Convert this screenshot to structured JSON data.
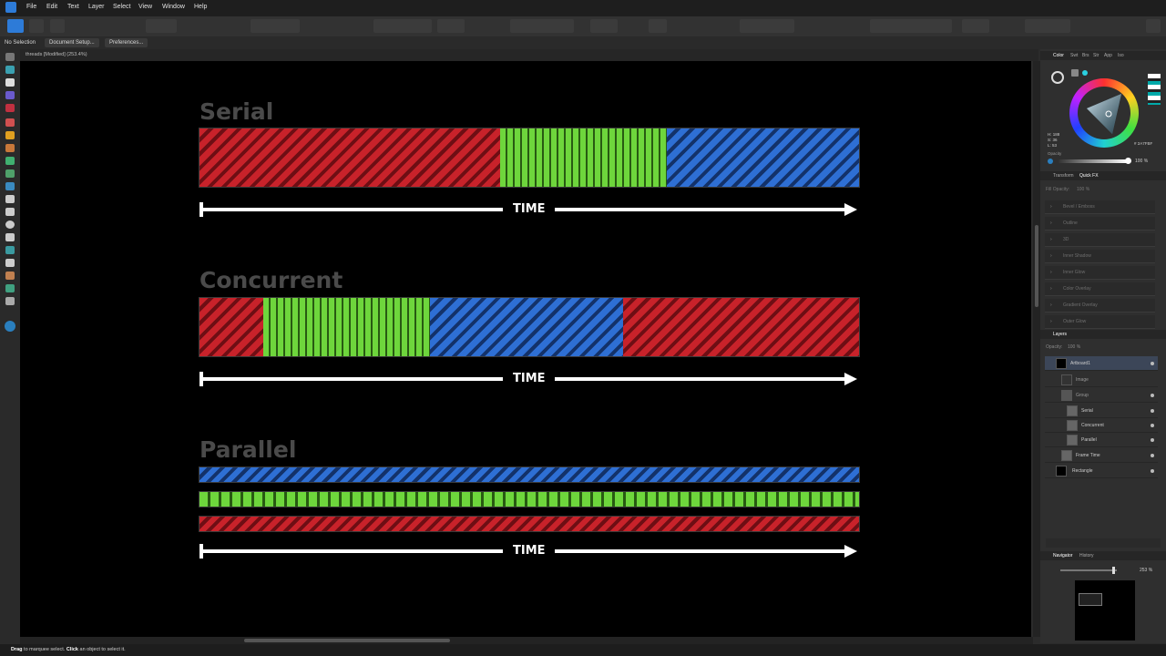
{
  "app": {
    "name": "Affinity Designer",
    "accent": "#2d7bd8"
  },
  "menu": [
    "File",
    "Edit",
    "Text",
    "Layer",
    "Select",
    "View",
    "Window",
    "Help"
  ],
  "context_bar": {
    "selection": "No Selection",
    "doc_setup": "Document Setup...",
    "preferences": "Preferences..."
  },
  "document": {
    "tab_title": "threads [Modified] (253.4%)"
  },
  "artwork": {
    "serial": {
      "title": "Serial",
      "time_label": "TIME",
      "segments": [
        "red",
        "green",
        "blue"
      ]
    },
    "concurrent": {
      "title": "Concurrent",
      "time_label": "TIME",
      "segments": [
        "red",
        "green",
        "blue",
        "red"
      ]
    },
    "parallel": {
      "title": "Parallel",
      "time_label": "TIME",
      "segments": [
        "blue",
        "green",
        "red"
      ]
    },
    "colors": {
      "red": "#c8222a",
      "green": "#6ed63c",
      "blue": "#2e6fd4"
    }
  },
  "color_panel": {
    "tabs": [
      "Color",
      "Swt",
      "Brs",
      "Str",
      "App",
      "Iso"
    ],
    "hsl": {
      "h": "H: 188",
      "s": "S: 36",
      "l": "L: 53"
    },
    "hex": "# 2A7FBF",
    "opacity_label": "Opacity",
    "opacity_value": "100 %"
  },
  "fx_panel": {
    "tabs": [
      "Transform",
      "Quick FX"
    ],
    "fill_opacity_label": "Fill Opacity:",
    "fill_opacity_value": "100 %",
    "effects": [
      "Bevel / Emboss",
      "Outline",
      "3D",
      "Inner Shadow",
      "Inner Glow",
      "Color Overlay",
      "Gradient Overlay",
      "Outer Glow"
    ]
  },
  "layers_panel": {
    "title": "Layers",
    "opacity_label": "Opacity:",
    "opacity_value": "100 %",
    "layers": [
      {
        "name": "Artboard1",
        "selected": true
      },
      {
        "name": "Image"
      },
      {
        "name": "Group"
      },
      {
        "name": "Serial"
      },
      {
        "name": "Concurrent"
      },
      {
        "name": "Parallel"
      },
      {
        "name": "Frame Time"
      },
      {
        "name": "Rectangle"
      }
    ]
  },
  "navigator": {
    "tabs": [
      "Navigator",
      "History"
    ],
    "zoom": "253 %"
  },
  "status": {
    "drag": "Drag",
    "drag_text": " to marquee select. ",
    "click": "Click",
    "click_text": " an object to select it."
  }
}
